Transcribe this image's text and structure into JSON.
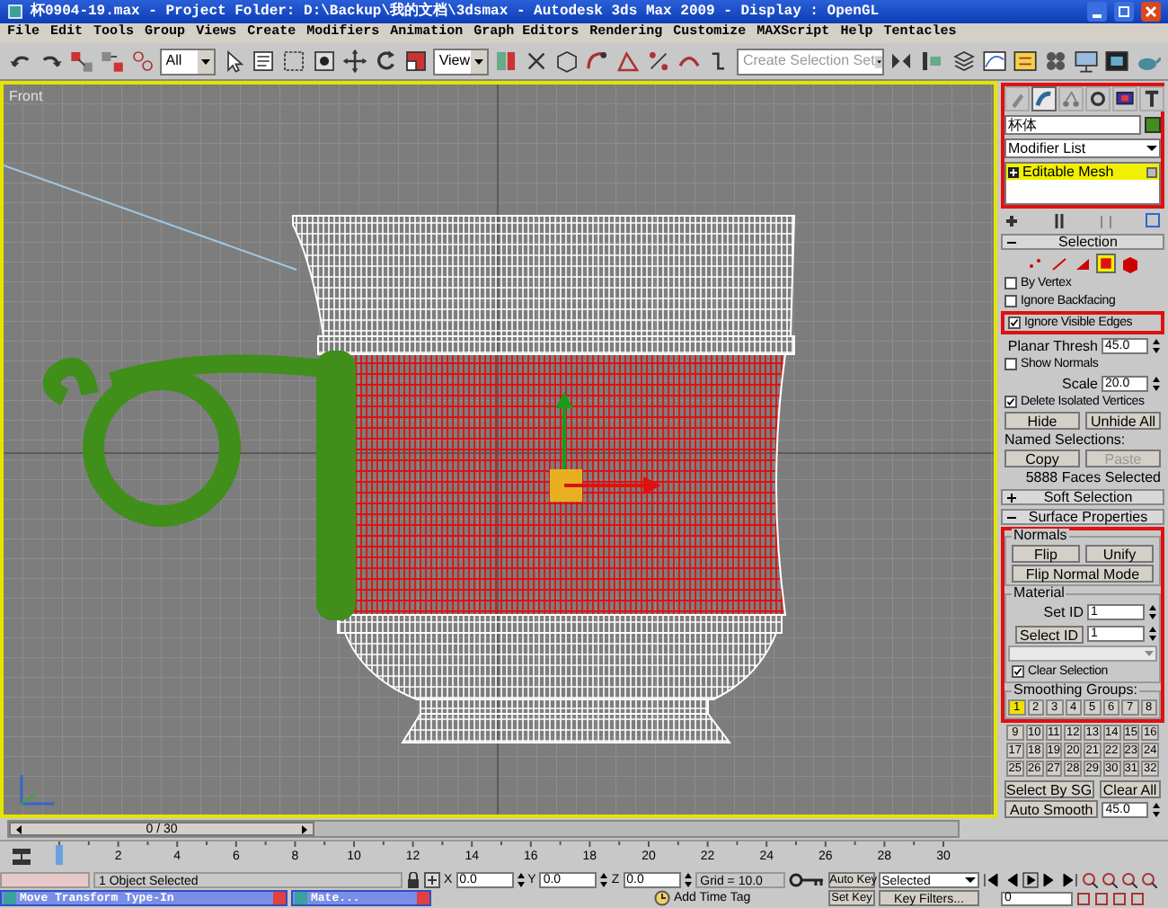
{
  "window": {
    "title": "杯0904-19.max - Project Folder: D:\\Backup\\我的文档\\3dsmax - Autodesk 3ds Max 2009 - Display : OpenGL"
  },
  "menu": [
    "File",
    "Edit",
    "Tools",
    "Group",
    "Views",
    "Create",
    "Modifiers",
    "Animation",
    "Graph Editors",
    "Rendering",
    "Customize",
    "MAXScript",
    "Help",
    "Tentacles"
  ],
  "toolbar": {
    "selection_filter": "All",
    "reference_coord": "View",
    "named_selection": {
      "placeholder": "Create Selection Set"
    }
  },
  "viewport": {
    "label": "Front",
    "active": true
  },
  "command_panel": {
    "tabs": [
      {
        "selected": false
      },
      {
        "selected": true
      },
      {
        "selected": false
      },
      {
        "selected": false
      },
      {
        "selected": false
      },
      {
        "selected": false
      }
    ],
    "object_name": "杯体",
    "modifier_list": "Modifier List",
    "stack": [
      {
        "label": "Editable Mesh",
        "selected": true
      }
    ],
    "header_highlighted": true,
    "selection": {
      "title": "Selection",
      "levels": [
        {
          "selected": false
        },
        {
          "selected": false
        },
        {
          "selected": false
        },
        {
          "selected": true
        },
        {
          "selected": false
        }
      ],
      "options": [
        {
          "kind": "check",
          "label": "By Vertex",
          "checked": false,
          "highlighted": false
        },
        {
          "kind": "check",
          "label": "Ignore Backfacing",
          "checked": false,
          "highlighted": false
        },
        {
          "kind": "check",
          "label": "Ignore Visible Edges",
          "checked": true,
          "highlighted": true
        },
        {
          "kind": "spinner",
          "label": "Planar Thresh",
          "value": "45.0"
        },
        {
          "kind": "check",
          "label": "Show Normals",
          "checked": false,
          "highlighted": false
        },
        {
          "kind": "spinner",
          "label": "Scale",
          "value": "20.0"
        },
        {
          "kind": "check",
          "label": "Delete Isolated Vertices",
          "checked": true,
          "highlighted": false
        }
      ],
      "hide": "Hide",
      "unhide": "Unhide All",
      "named_label": "Named Selections:",
      "copy": {
        "label": "Copy",
        "disabled": false
      },
      "paste": {
        "label": "Paste",
        "disabled": true
      },
      "status": "5888 Faces Selected"
    },
    "rollouts": [
      {
        "title": "Soft Selection",
        "expanded": false
      },
      {
        "title": "Surface Properties",
        "expanded": true
      }
    ],
    "surface": {
      "highlighted": true,
      "normals_title": "Normals",
      "flip": "Flip",
      "unify": "Unify",
      "flip_mode": "Flip Normal Mode",
      "material_title": "Material",
      "set_id": {
        "label": "Set ID",
        "value": "1"
      },
      "select_id": {
        "label": "Select ID",
        "value": "1"
      },
      "clear_selection": {
        "label": "Clear Selection",
        "checked": true
      },
      "smoothing_title": "Smoothing Groups:",
      "groups": [
        {
          "label": "1",
          "selected": true
        },
        {
          "label": "2",
          "selected": false
        },
        {
          "label": "3",
          "selected": false
        },
        {
          "label": "4",
          "selected": false
        },
        {
          "label": "5",
          "selected": false
        },
        {
          "label": "6",
          "selected": false
        },
        {
          "label": "7",
          "selected": false
        },
        {
          "label": "8",
          "selected": false
        },
        {
          "label": "9",
          "selected": false
        },
        {
          "label": "10",
          "selected": false
        },
        {
          "label": "11",
          "selected": false
        },
        {
          "label": "12",
          "selected": false
        },
        {
          "label": "13",
          "selected": false
        },
        {
          "label": "14",
          "selected": false
        },
        {
          "label": "15",
          "selected": false
        },
        {
          "label": "16",
          "selected": false
        },
        {
          "label": "17",
          "selected": false
        },
        {
          "label": "18",
          "selected": false
        },
        {
          "label": "19",
          "selected": false
        },
        {
          "label": "20",
          "selected": false
        },
        {
          "label": "21",
          "selected": false
        },
        {
          "label": "22",
          "selected": false
        },
        {
          "label": "23",
          "selected": false
        },
        {
          "label": "24",
          "selected": false
        },
        {
          "label": "25",
          "selected": false
        },
        {
          "label": "26",
          "selected": false
        },
        {
          "label": "27",
          "selected": false
        },
        {
          "label": "28",
          "selected": false
        },
        {
          "label": "29",
          "selected": false
        },
        {
          "label": "30",
          "selected": false
        },
        {
          "label": "31",
          "selected": false
        },
        {
          "label": "32",
          "selected": false
        }
      ],
      "select_by_sg": "Select By SG",
      "clear_all": "Clear All",
      "auto_smooth": {
        "label": "Auto Smooth",
        "value": "45.0"
      }
    }
  },
  "timeline": {
    "thumb": "0 / 30",
    "level": 0,
    "ruler": [
      "2",
      "4",
      "6",
      "8",
      "10",
      "12",
      "14",
      "16",
      "18",
      "20",
      "22",
      "24",
      "26",
      "28",
      "30"
    ]
  },
  "status": {
    "selected": "1 Object Selected",
    "x": {
      "label": "X",
      "value": "0.0"
    },
    "y": {
      "label": "Y",
      "value": "0.0"
    },
    "z": {
      "label": "Z",
      "value": "0.0"
    },
    "grid": "Grid = 10.0",
    "time_tag": "Add Time Tag",
    "auto_key": "Auto Key",
    "set_key": "Set Key",
    "key_mode": "Selected",
    "key_filters": "Key Filters...",
    "frame": "0",
    "minimized": [
      {
        "title": "Move Transform Type-In"
      },
      {
        "title": "Mate..."
      }
    ]
  }
}
